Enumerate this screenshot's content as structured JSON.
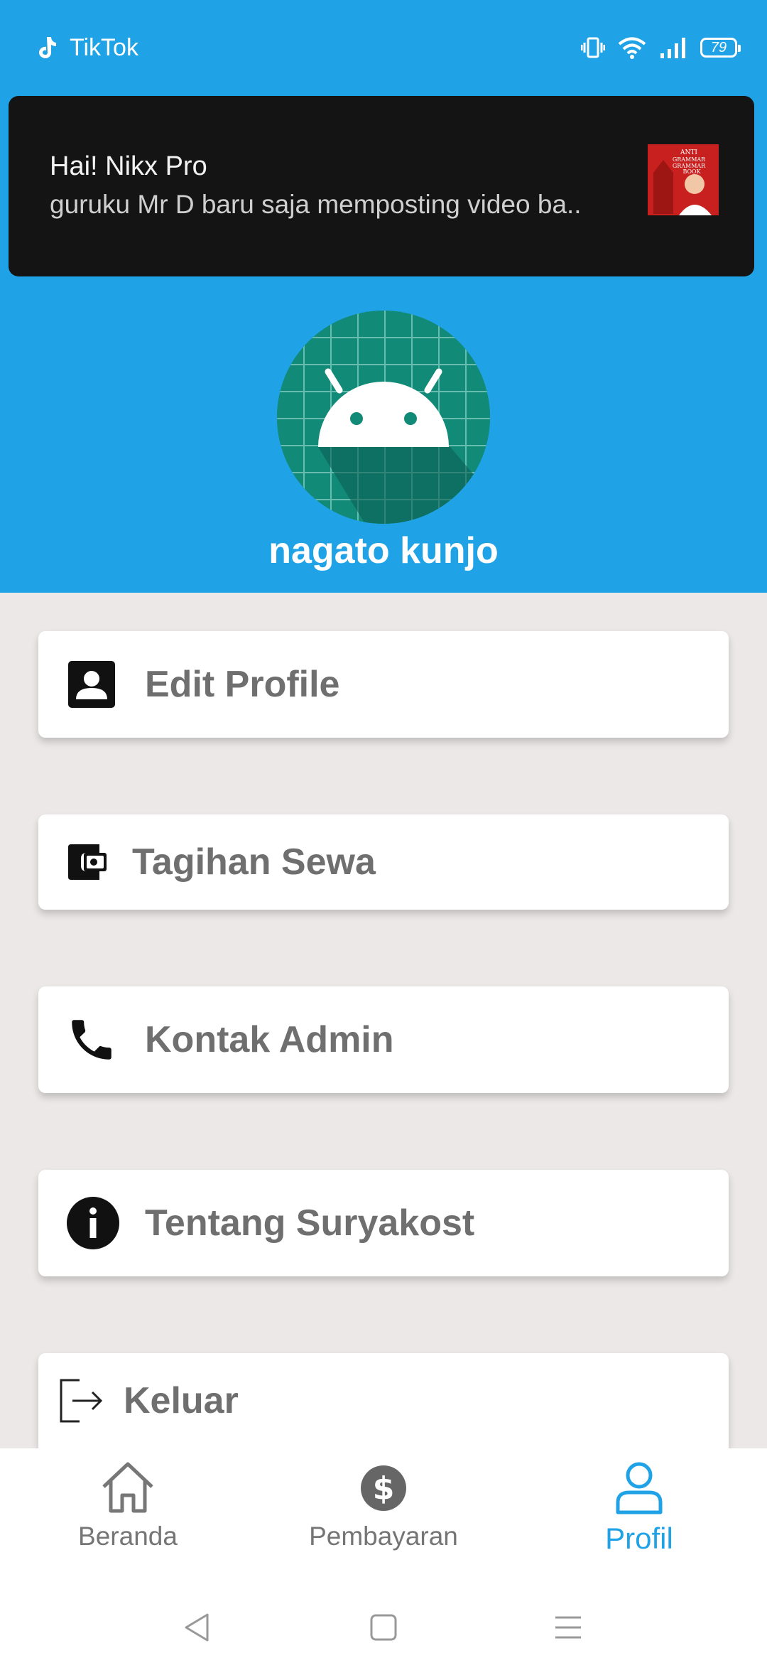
{
  "status_bar": {
    "app_name": "TikTok",
    "battery": "79"
  },
  "notification": {
    "title": "Hai! Nikx Pro",
    "text": "guruku Mr D baru saja memposting video ba..",
    "thumbnail_text": "ANTI GRAMMAR GRAMMAR BOOK"
  },
  "profile": {
    "username": "nagato kunjo"
  },
  "menu": {
    "items": [
      {
        "label": "Edit Profile",
        "icon": "account-box-icon"
      },
      {
        "label": "Tagihan Sewa",
        "icon": "wallet-icon"
      },
      {
        "label": "Kontak Admin",
        "icon": "phone-icon"
      },
      {
        "label": "Tentang Suryakost",
        "icon": "info-icon"
      },
      {
        "label": "Keluar",
        "icon": "logout-icon"
      }
    ]
  },
  "bottom_nav": {
    "items": [
      {
        "label": "Beranda",
        "icon": "home-icon"
      },
      {
        "label": "Pembayaran",
        "icon": "dollar-icon"
      },
      {
        "label": "Profil",
        "icon": "person-icon",
        "active": true
      }
    ]
  },
  "colors": {
    "primary": "#20a3e6",
    "background": "#ebe8e7",
    "menu_text": "#6f6f6f",
    "notification_bg": "#141414"
  }
}
